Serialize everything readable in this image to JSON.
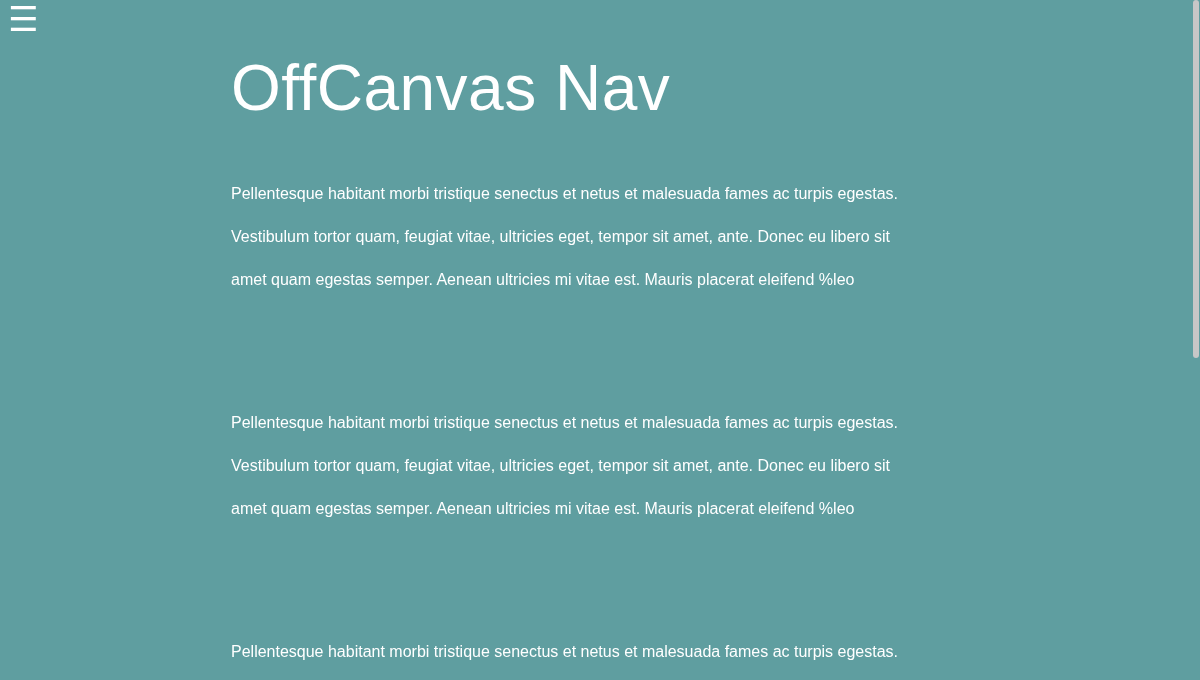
{
  "menu_button": {
    "label": "☰"
  },
  "title": "OffCanvas Nav",
  "paragraphs": [
    {
      "lines": [
        "Pellentesque habitant morbi tristique senectus et netus et malesuada fames ac turpis egestas.",
        "Vestibulum tortor quam, feugiat vitae, ultricies eget, tempor sit amet, ante. Donec eu libero sit",
        "amet quam egestas semper. Aenean ultricies mi vitae est. Mauris placerat eleifend %leo"
      ]
    },
    {
      "lines": [
        "Pellentesque habitant morbi tristique senectus et netus et malesuada fames ac turpis egestas.",
        "Vestibulum tortor quam, feugiat vitae, ultricies eget, tempor sit amet, ante. Donec eu libero sit",
        "amet quam egestas semper. Aenean ultricies mi vitae est. Mauris placerat eleifend %leo"
      ]
    },
    {
      "lines": [
        "Pellentesque habitant morbi tristique senectus et netus et malesuada fames ac turpis egestas."
      ]
    }
  ]
}
